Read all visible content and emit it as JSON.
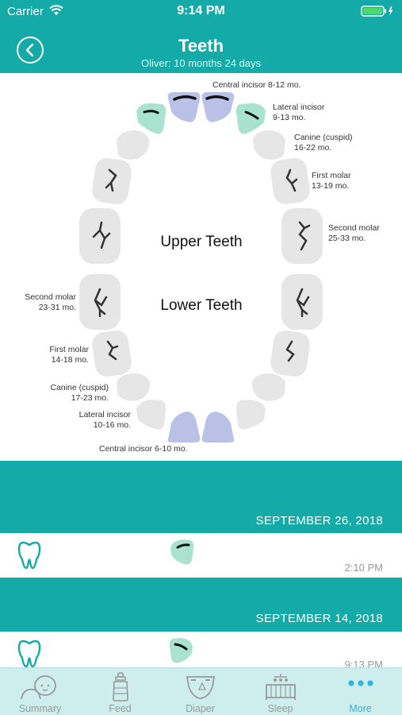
{
  "status_bar": {
    "carrier": "Carrier",
    "time": "9:14 PM"
  },
  "header": {
    "title": "Teeth",
    "subtitle": "Oliver: 10 months 24 days"
  },
  "chart": {
    "upper_heading": "Upper Teeth",
    "lower_heading": "Lower Teeth",
    "upper_labels": {
      "central": "Central incisor 8-12 mo.",
      "lateral_name": "Lateral incisor",
      "lateral_age": "9-13 mo.",
      "canine_name": "Canine (cuspid)",
      "canine_age": "16-22 mo.",
      "first_molar_name": "First molar",
      "first_molar_age": "13-19 mo.",
      "second_molar_name": "Second molar",
      "second_molar_age": "25-33 mo."
    },
    "lower_labels": {
      "second_molar_name": "Second molar",
      "second_molar_age": "23-31 mo.",
      "first_molar_name": "First molar",
      "first_molar_age": "14-18 mo.",
      "canine_name": "Canine (cuspid)",
      "canine_age": "17-23 mo.",
      "lateral_name": "Lateral incisor",
      "lateral_age": "10-16 mo.",
      "central": "Central incisor 6-10 mo."
    },
    "colors": {
      "erupted_green": "#a9e2cf",
      "expected_blue": "#b9c2e6",
      "pending_gray": "#e6e6e6"
    }
  },
  "log": [
    {
      "date": "SEPTEMBER 26, 2018",
      "time": "2:10 PM",
      "tooth": "upper-left-lateral-incisor"
    },
    {
      "date": "SEPTEMBER 14, 2018",
      "time": "9:13 PM",
      "tooth": "upper-right-lateral-incisor"
    }
  ],
  "tabs": [
    {
      "label": "Summary",
      "icon": "baby-icon",
      "active": false
    },
    {
      "label": "Feed",
      "icon": "bottle-icon",
      "active": false
    },
    {
      "label": "Diaper",
      "icon": "diaper-icon",
      "active": false
    },
    {
      "label": "Sleep",
      "icon": "crib-icon",
      "active": false
    },
    {
      "label": "More",
      "icon": "more-dots-icon",
      "active": true
    }
  ]
}
